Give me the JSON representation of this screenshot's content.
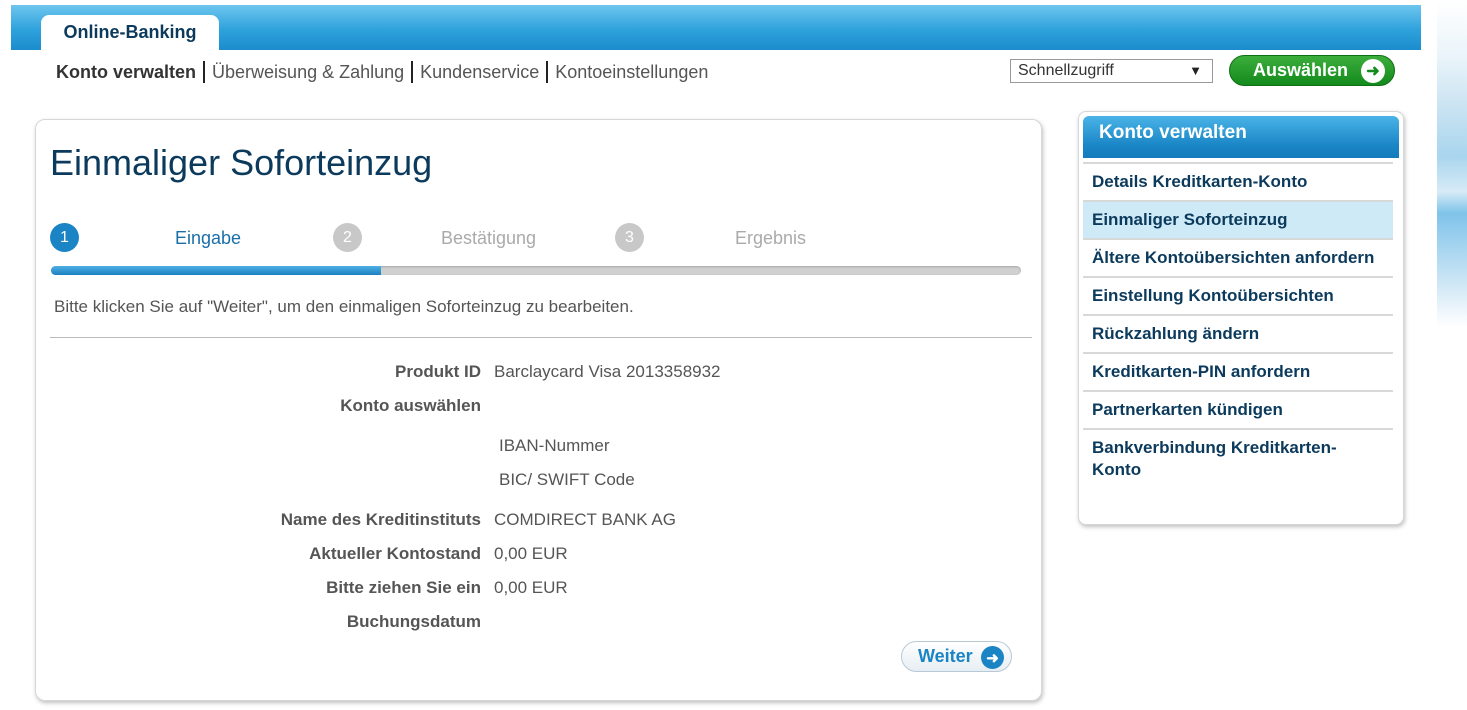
{
  "header": {
    "tab_label": "Online-Banking"
  },
  "nav": {
    "items": [
      "Konto verwalten",
      "Überweisung & Zahlung",
      "Kundenservice",
      "Kontoeinstellungen"
    ]
  },
  "quick_access": {
    "selected": "Schnellzugriff",
    "button_label": "Auswählen"
  },
  "main": {
    "title": "Einmaliger Soforteinzug",
    "steps": [
      {
        "number": "1",
        "label": "Eingabe",
        "state": "active"
      },
      {
        "number": "2",
        "label": "Bestätigung",
        "state": "inactive"
      },
      {
        "number": "3",
        "label": "Ergebnis",
        "state": "inactive"
      }
    ],
    "progress": 0.34,
    "instruction": "Bitte klicken Sie auf \"Weiter\", um den einmaligen Soforteinzug zu bearbeiten.",
    "form": {
      "product_label": "Produkt ID",
      "product_value": "Barclaycard Visa 2013358932",
      "account_label": "Konto auswählen",
      "iban_label": "IBAN-Nummer",
      "bic_label": "BIC/ SWIFT Code",
      "bank_label": "Name des Kreditinstituts",
      "bank_value": "COMDIRECT BANK AG",
      "balance_label": "Aktueller Kontostand",
      "balance_value": "0,00 EUR",
      "debit_label": "Bitte ziehen Sie ein",
      "debit_value": "0,00 EUR",
      "booking_label": "Buchungsdatum"
    },
    "next_button": "Weiter"
  },
  "sidebar": {
    "title": "Konto verwalten",
    "items": [
      "Details Kreditkarten-Konto",
      "Einmaliger Soforteinzug",
      "Ältere Kontoübersichten anfordern",
      "Einstellung Kontoübersichten",
      "Rückzahlung ändern",
      "Kreditkarten-PIN anfordern",
      "Partnerkarten kündigen",
      "Bankverbindung Kreditkarten-Konto"
    ]
  }
}
